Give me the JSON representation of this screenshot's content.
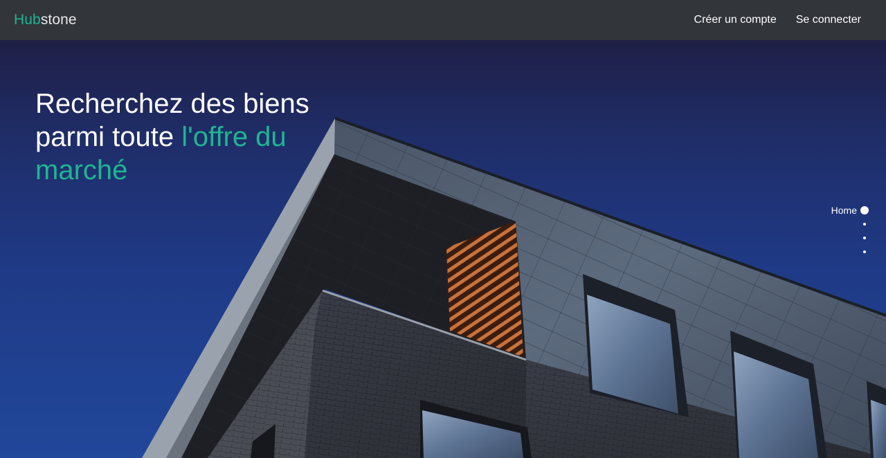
{
  "navbar": {
    "brand_accent": "Hub",
    "brand_rest": "stone",
    "links": [
      "Créer un compte",
      "Se connecter"
    ]
  },
  "hero": {
    "headline_part1": "Recherchez des biens parmi toute ",
    "headline_accent": "l'offre du marché"
  },
  "page_nav": {
    "active_label": "Home",
    "sections_count": 4
  },
  "colors": {
    "accent": "#1fb592",
    "navbar_bg": "#32353a",
    "sky": "#1f3a86"
  }
}
